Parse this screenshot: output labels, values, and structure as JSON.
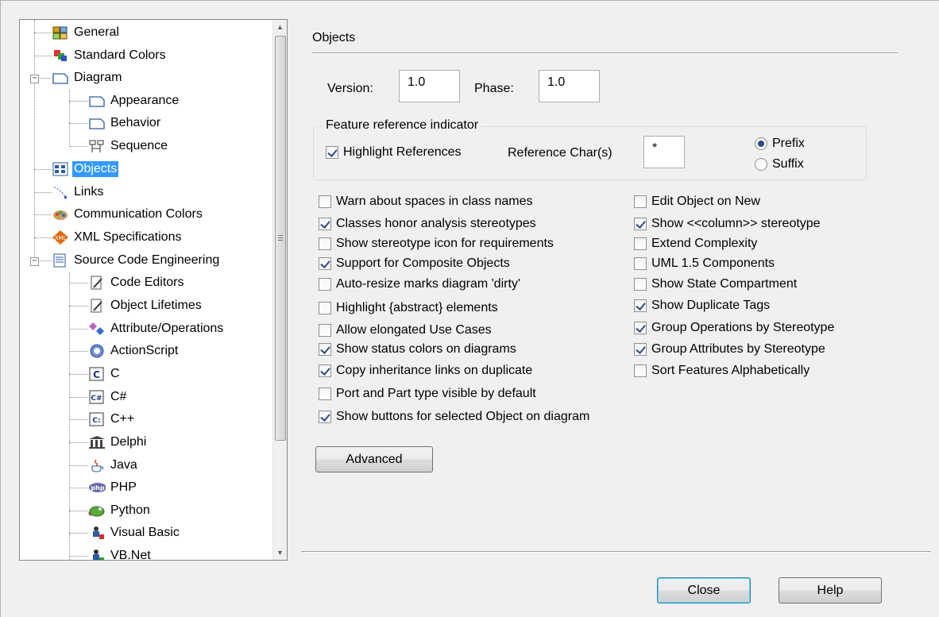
{
  "tree": {
    "items": [
      {
        "label": "General",
        "icon": "general-icon"
      },
      {
        "label": "Standard Colors",
        "icon": "colors-icon"
      },
      {
        "label": "Diagram",
        "icon": "diagram-icon"
      },
      {
        "label": "Appearance",
        "icon": "page-icon"
      },
      {
        "label": "Behavior",
        "icon": "page-icon"
      },
      {
        "label": "Sequence",
        "icon": "sequence-icon"
      },
      {
        "label": "Objects",
        "icon": "objects-icon"
      },
      {
        "label": "Links",
        "icon": "links-icon"
      },
      {
        "label": "Communication Colors",
        "icon": "communication-icon"
      },
      {
        "label": "XML Specifications",
        "icon": "xml-icon"
      },
      {
        "label": "Source Code Engineering",
        "icon": "source-code-icon"
      },
      {
        "label": "Code Editors",
        "icon": "editor-icon"
      },
      {
        "label": "Object Lifetimes",
        "icon": "editor-icon"
      },
      {
        "label": "Attribute/Operations",
        "icon": "attribute-icon"
      },
      {
        "label": "ActionScript",
        "icon": "actionscript-icon"
      },
      {
        "label": "C",
        "icon": "c-icon"
      },
      {
        "label": "C#",
        "icon": "csharp-icon"
      },
      {
        "label": "C++",
        "icon": "cpp-icon"
      },
      {
        "label": "Delphi",
        "icon": "delphi-icon"
      },
      {
        "label": "Java",
        "icon": "java-icon"
      },
      {
        "label": "PHP",
        "icon": "php-icon"
      },
      {
        "label": "Python",
        "icon": "python-icon"
      },
      {
        "label": "Visual Basic",
        "icon": "vb-icon"
      },
      {
        "label": "VB.Net",
        "icon": "vbnet-icon"
      }
    ],
    "selected": "Objects",
    "expanded_collapse_glyph": "⊟"
  },
  "panel": {
    "title": "Objects",
    "version_label": "Version:",
    "version_value": "1.0",
    "phase_label": "Phase:",
    "phase_value": "1.0",
    "feature_group": {
      "legend": "Feature reference indicator",
      "highlight_label": "Highlight References",
      "highlight_checked": true,
      "refchar_label": "Reference Char(s)",
      "refchar_value": "*",
      "prefix_label": "Prefix",
      "suffix_label": "Suffix",
      "selected": "Prefix"
    },
    "left_options": [
      {
        "label": "Warn about spaces in class names",
        "checked": false
      },
      {
        "label": "Classes honor analysis stereotypes",
        "checked": true
      },
      {
        "label": "Show stereotype icon for requirements",
        "checked": false
      },
      {
        "label": "Support for Composite Objects",
        "checked": true
      },
      {
        "label": "Auto-resize marks diagram 'dirty'",
        "checked": false
      },
      {
        "label": "Highlight {abstract} elements",
        "checked": false
      },
      {
        "label": "Allow elongated Use Cases",
        "checked": false
      },
      {
        "label": "Show status colors on diagrams",
        "checked": true
      },
      {
        "label": "Copy inheritance links on duplicate",
        "checked": true
      },
      {
        "label": "Port and Part type visible by default",
        "checked": false
      },
      {
        "label": "Show buttons for selected Object on diagram",
        "checked": true
      }
    ],
    "right_options": [
      {
        "label": "Edit Object on New",
        "checked": false
      },
      {
        "label": "Show <<column>> stereotype",
        "checked": true
      },
      {
        "label": "Extend Complexity",
        "checked": false
      },
      {
        "label": "UML 1.5 Components",
        "checked": false
      },
      {
        "label": "Show State Compartment",
        "checked": false
      },
      {
        "label": "Show Duplicate Tags",
        "checked": true
      },
      {
        "label": "Group Operations by Stereotype",
        "checked": true
      },
      {
        "label": "Group Attributes by Stereotype",
        "checked": true
      },
      {
        "label": "Sort Features Alphabetically",
        "checked": false
      }
    ],
    "advanced_label": "Advanced"
  },
  "footer": {
    "close_label": "Close",
    "help_label": "Help"
  }
}
